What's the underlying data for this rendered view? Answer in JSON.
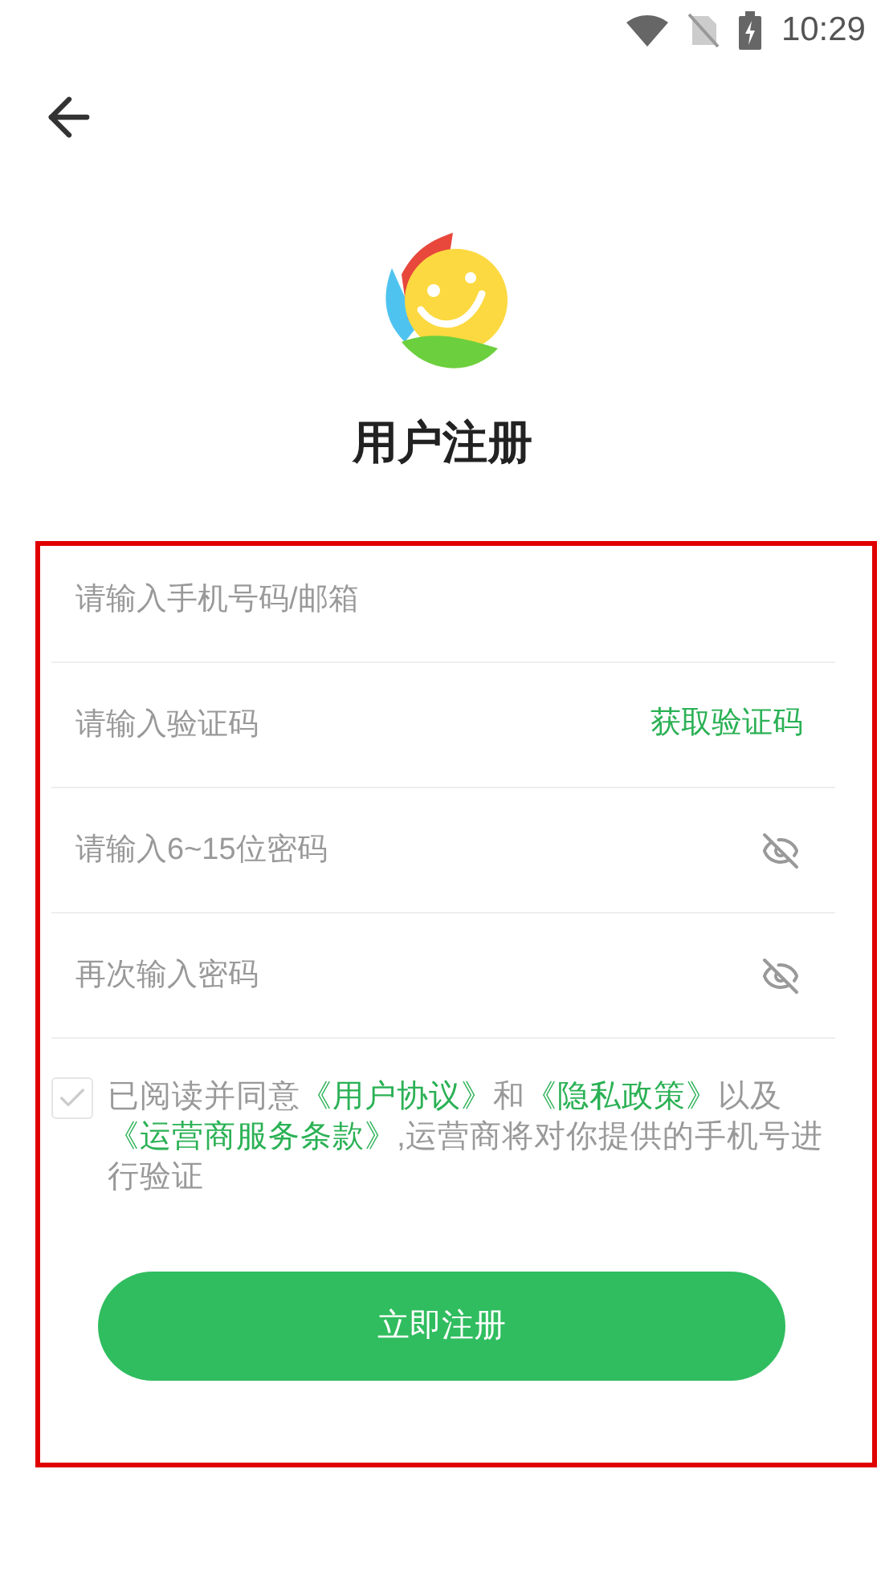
{
  "status_bar": {
    "time": "10:29"
  },
  "title": "用户注册",
  "fields": [
    {
      "kind": "text",
      "placeholder": "请输入手机号码/邮箱"
    },
    {
      "kind": "code",
      "placeholder": "请输入验证码",
      "action": "获取验证码"
    },
    {
      "kind": "password",
      "placeholder": "请输入6~15位密码"
    },
    {
      "kind": "password",
      "placeholder": "再次输入密码"
    }
  ],
  "agreement": {
    "checked": false,
    "segments": [
      {
        "kind": "text",
        "text": "已阅读并同意"
      },
      {
        "kind": "link",
        "text": "《用户协议》"
      },
      {
        "kind": "text",
        "text": "和"
      },
      {
        "kind": "link",
        "text": "《隐私政策》"
      },
      {
        "kind": "text",
        "text": "以及"
      },
      {
        "kind": "link",
        "text": "《运营商服务条款》"
      },
      {
        "kind": "text",
        "text": ",运营商将对你提供的手机号进行验证"
      }
    ]
  },
  "submit": "立即注册"
}
